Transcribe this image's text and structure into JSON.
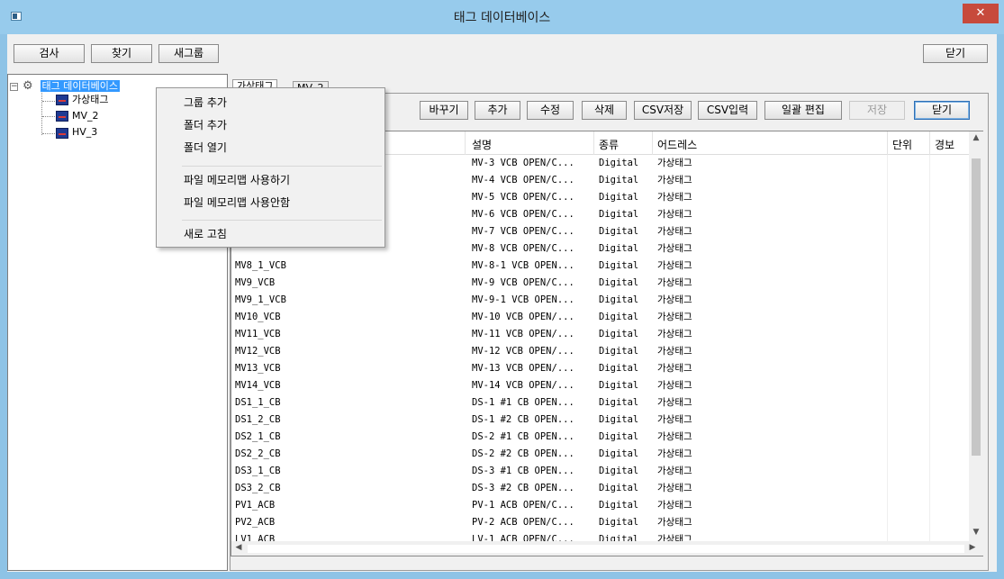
{
  "window": {
    "title": "태그 데이터베이스",
    "close_glyph": "✕"
  },
  "toolbar": {
    "inspect": "검사",
    "find": "찾기",
    "new_group": "새그룹",
    "close": "닫기"
  },
  "tree": {
    "root": "태그 데이터베이스",
    "children": [
      "가상태그",
      "MV_2",
      "HV_3"
    ]
  },
  "tabs": [
    "가상태그",
    "MV_2"
  ],
  "action_buttons": {
    "replace": "바꾸기",
    "add": "추가",
    "edit": "수정",
    "delete": "삭제",
    "csv_save": "CSV저장",
    "csv_input": "CSV입력",
    "batch_edit": "일괄 편집",
    "save": "저장",
    "close": "닫기"
  },
  "grid": {
    "headers": {
      "desc": "설명",
      "type": "종류",
      "address": "어드레스",
      "unit": "단위",
      "alarm": "경보"
    },
    "rows": [
      [
        "",
        "MV-3 VCB OPEN/C...",
        "Digital",
        "가상태그"
      ],
      [
        "",
        "MV-4 VCB OPEN/C...",
        "Digital",
        "가상태그"
      ],
      [
        "",
        "MV-5 VCB OPEN/C...",
        "Digital",
        "가상태그"
      ],
      [
        "",
        "MV-6 VCB OPEN/C...",
        "Digital",
        "가상태그"
      ],
      [
        "",
        "MV-7 VCB OPEN/C...",
        "Digital",
        "가상태그"
      ],
      [
        "",
        "MV-8 VCB OPEN/C...",
        "Digital",
        "가상태그"
      ],
      [
        "MV8_1_VCB",
        "MV-8-1 VCB OPEN...",
        "Digital",
        "가상태그"
      ],
      [
        "MV9_VCB",
        "MV-9 VCB OPEN/C...",
        "Digital",
        "가상태그"
      ],
      [
        "MV9_1_VCB",
        "MV-9-1 VCB OPEN...",
        "Digital",
        "가상태그"
      ],
      [
        "MV10_VCB",
        "MV-10 VCB OPEN/...",
        "Digital",
        "가상태그"
      ],
      [
        "MV11_VCB",
        "MV-11 VCB OPEN/...",
        "Digital",
        "가상태그"
      ],
      [
        "MV12_VCB",
        "MV-12 VCB OPEN/...",
        "Digital",
        "가상태그"
      ],
      [
        "MV13_VCB",
        "MV-13 VCB OPEN/...",
        "Digital",
        "가상태그"
      ],
      [
        "MV14_VCB",
        "MV-14 VCB OPEN/...",
        "Digital",
        "가상태그"
      ],
      [
        "DS1_1_CB",
        "DS-1 #1 CB OPEN...",
        "Digital",
        "가상태그"
      ],
      [
        "DS1_2_CB",
        "DS-1 #2 CB OPEN...",
        "Digital",
        "가상태그"
      ],
      [
        "DS2_1_CB",
        "DS-2 #1 CB OPEN...",
        "Digital",
        "가상태그"
      ],
      [
        "DS2_2_CB",
        "DS-2 #2 CB OPEN...",
        "Digital",
        "가상태그"
      ],
      [
        "DS3_1_CB",
        "DS-3 #1 CB OPEN...",
        "Digital",
        "가상태그"
      ],
      [
        "DS3_2_CB",
        "DS-3 #2 CB OPEN...",
        "Digital",
        "가상태그"
      ],
      [
        "PV1_ACB",
        "PV-1 ACB OPEN/C...",
        "Digital",
        "가상태그"
      ],
      [
        "PV2_ACB",
        "PV-2 ACB OPEN/C...",
        "Digital",
        "가상태그"
      ],
      [
        "LV1_ACB",
        "LV-1 ACB OPEN/C...",
        "Digital",
        "가상태그"
      ]
    ]
  },
  "context_menu": {
    "add_group": "그룹 추가",
    "add_folder": "폴더 추가",
    "open_folder": "폴더 열기",
    "use_memmap": "파일 메모리맵 사용하기",
    "no_memmap": "파일 메모리맵 사용안함",
    "refresh": "새로 고침"
  },
  "colors": {
    "titlebar": "#97cbec",
    "selection": "#3399ff",
    "close": "#c74a3c"
  }
}
